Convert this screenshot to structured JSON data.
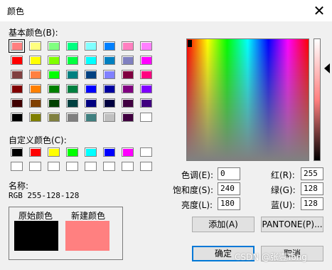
{
  "window": {
    "title": "颜色",
    "close_glyph": "✕"
  },
  "basic": {
    "label": "基本颜色(B):",
    "colors": [
      [
        "#ff8080",
        "#ffff80",
        "#80ff80",
        "#00ff80",
        "#80ffff",
        "#0080ff",
        "#ff80c0",
        "#ff80ff"
      ],
      [
        "#ff0000",
        "#ffff00",
        "#80ff00",
        "#00ff40",
        "#00ffff",
        "#0080c0",
        "#8080c0",
        "#ff00ff"
      ],
      [
        "#804040",
        "#ff8040",
        "#00ff00",
        "#008080",
        "#004080",
        "#8080ff",
        "#800040",
        "#ff0080"
      ],
      [
        "#800000",
        "#ff8000",
        "#008000",
        "#008040",
        "#0000ff",
        "#0000a0",
        "#800080",
        "#8000ff"
      ],
      [
        "#400000",
        "#804000",
        "#004000",
        "#004040",
        "#000080",
        "#000040",
        "#400040",
        "#400080"
      ],
      [
        "#000000",
        "#808000",
        "#808040",
        "#808080",
        "#408080",
        "#c0c0c0",
        "#400040",
        "#ffffff"
      ]
    ]
  },
  "custom": {
    "label": "自定义颜色(C):",
    "colors": [
      [
        "#000000",
        "#ff0000",
        "#ffff00",
        "#00ff00",
        "#00ffff",
        "#0000ff",
        "#ff00ff",
        "#ffffff"
      ],
      [
        "#ffffff",
        "#ffffff",
        "#ffffff",
        "#ffffff",
        "#ffffff",
        "#ffffff",
        "#ffffff",
        "#ffffff"
      ]
    ]
  },
  "name": {
    "label": "名称:",
    "value": "RGB 255-128-128"
  },
  "preview": {
    "original_label": "原始颜色",
    "new_label": "新建颜色",
    "original_color": "#000000",
    "new_color": "#ff8080"
  },
  "hsl": {
    "hue_label": "色调(E):",
    "hue": "0",
    "sat_label": "饱和度(S):",
    "sat": "240",
    "lum_label": "亮度(L):",
    "lum": "180"
  },
  "rgb": {
    "red_label": "红(R):",
    "red": "255",
    "green_label": "绿(G):",
    "green": "128",
    "blue_label": "蓝(U):",
    "blue": "128"
  },
  "buttons": {
    "add": "添加(A)",
    "pantone": "PANTONE(P)...",
    "ok": "确定",
    "cancel": "取消"
  },
  "watermark": "CSDN @张壹Tong"
}
